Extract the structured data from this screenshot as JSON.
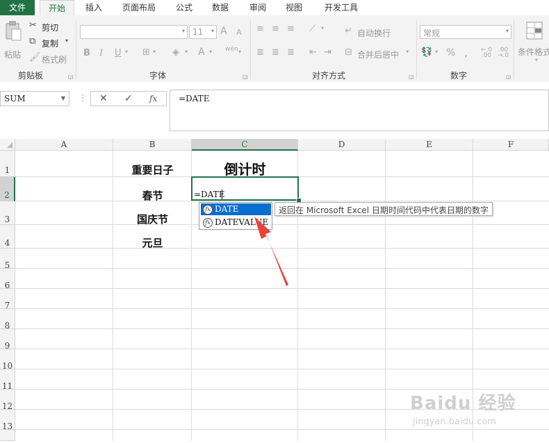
{
  "tabs": [
    "文件",
    "开始",
    "插入",
    "页面布局",
    "公式",
    "数据",
    "审阅",
    "视图",
    "开发工具"
  ],
  "ribbon": {
    "clipboard": {
      "paste": "粘贴",
      "cut": "剪切",
      "copy": "复制",
      "format_painter": "格式刷",
      "label": "剪贴板"
    },
    "font": {
      "size": "11",
      "label": "字体",
      "bold": "B",
      "italic": "I",
      "underline": "U",
      "font_grow": "A",
      "font_shrink": "A",
      "font_color": "A",
      "phonetic": "wén"
    },
    "alignment": {
      "wrap_text": "自动换行",
      "merge_center": "合并后居中",
      "label": "对齐方式"
    },
    "number": {
      "format": "常规",
      "label": "数字",
      "percent": "%",
      "comma": ","
    },
    "styles": {
      "conditional_format": "条件格式"
    }
  },
  "formula_bar": {
    "name_box": "SUM",
    "formula": "=DATE",
    "cancel": "✕",
    "enter": "✓",
    "fx": "fx"
  },
  "columns": [
    "A",
    "B",
    "C",
    "D",
    "E",
    "F"
  ],
  "rows": [
    "1",
    "2",
    "3",
    "4",
    "5",
    "6",
    "7",
    "8",
    "9",
    "10",
    "11",
    "12",
    "13"
  ],
  "cells": {
    "B1": "重要日子",
    "C1": "倒计时",
    "B2": "春节",
    "B3": "国庆节",
    "B4": "元旦",
    "C2": "=DATE"
  },
  "autocomplete": {
    "items": [
      "DATE",
      "DATEVALUE"
    ],
    "tooltip": "返回在 Microsoft Excel 日期时间代码中代表日期的数字"
  },
  "watermark": {
    "brand": "Baidu 经验",
    "url": "jingyan.baidu.com"
  },
  "colors": {
    "excel_green": "#217346",
    "selection_blue": "#0a6ed1",
    "arrow_red": "#e8423b"
  }
}
